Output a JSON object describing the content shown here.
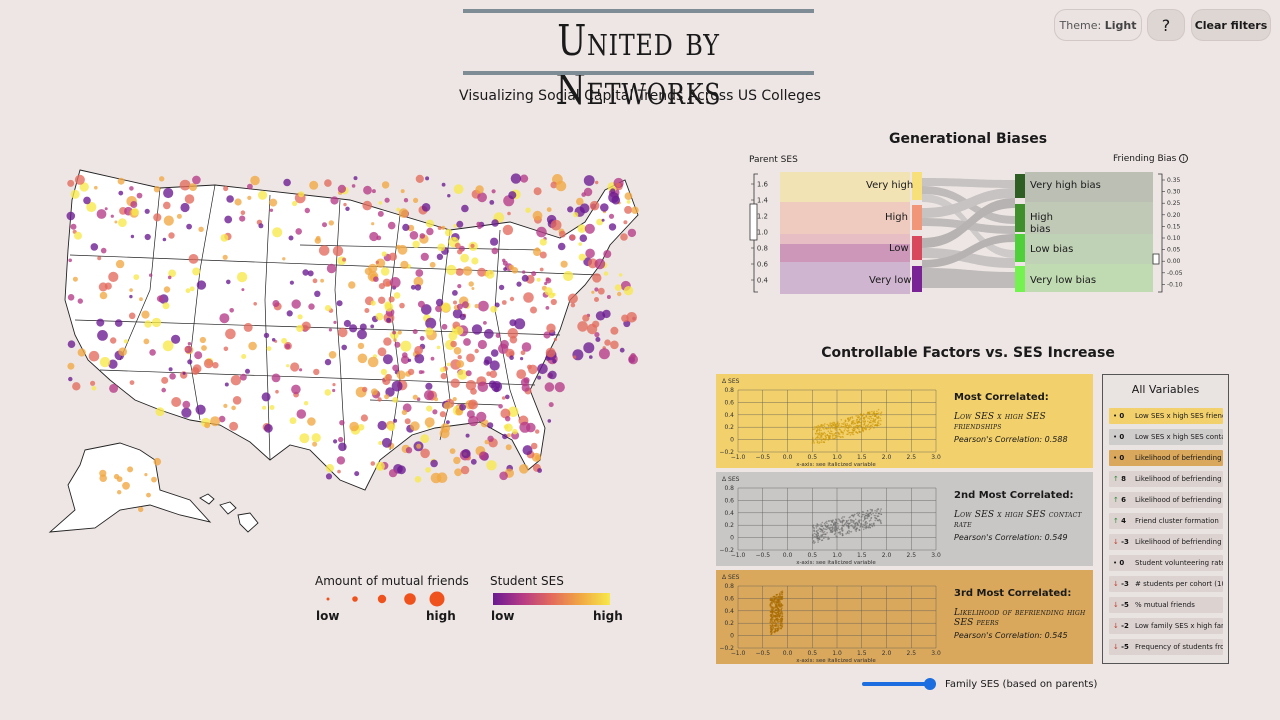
{
  "header": {
    "title": "United by Networks",
    "subtitle": "Visualizing Social Capital Trends Across US Colleges"
  },
  "controls": {
    "theme_prefix": "Theme:",
    "theme_value": "Light",
    "help_label": "?",
    "clear_label": "Clear filters"
  },
  "legend": {
    "size_title": "Amount of mutual friends",
    "size_low": "low",
    "size_high": "high",
    "color_title": "Student SES",
    "color_low": "low",
    "color_high": "high",
    "colors": [
      "#6a1a91",
      "#b53a86",
      "#e36a5c",
      "#f1a843",
      "#f7e84a"
    ]
  },
  "sankey": {
    "title": "Generational Biases",
    "left_axis_title": "Parent SES",
    "right_axis_title": "Friending Bias",
    "info_icon": "info-icon",
    "left_ticks": [
      "1.6",
      "1.4",
      "1.2",
      "1.0",
      "0.8",
      "0.6",
      "0.4"
    ],
    "right_ticks": [
      "0.35",
      "0.30",
      "0.25",
      "0.20",
      "0.15",
      "0.10",
      "0.05",
      "0.00",
      "-0.05",
      "-0.10"
    ],
    "left_nodes": [
      {
        "label": "Very high",
        "color": "#f7e07a"
      },
      {
        "label": "High",
        "color": "#f2967a"
      },
      {
        "label": "Low",
        "color": "#d9495e"
      },
      {
        "label": "Very low",
        "color": "#7a2396"
      }
    ],
    "right_nodes": [
      {
        "label": "Very high bias",
        "color": "#2f5e25"
      },
      {
        "label": "High bias",
        "color": "#3f8f2c"
      },
      {
        "label": "Low bias",
        "color": "#4fcf39"
      },
      {
        "label": "Very low bias",
        "color": "#74f24f"
      }
    ]
  },
  "factors": {
    "title": "Controllable Factors vs. SES Increase",
    "axis_y_label": "Δ SES",
    "axis_x_note": "x-axis: see italicized variable",
    "y_ticks": [
      "0.8",
      "0.6",
      "0.4",
      "0.2",
      "0",
      "−0.2"
    ],
    "x_ticks": [
      "−1.0",
      "−0.5",
      "0.0",
      "0.5",
      "1.0",
      "1.5",
      "2.0",
      "2.5",
      "3.0"
    ],
    "panels": [
      {
        "heading": "Most Correlated:",
        "variable": "Low SES x high SES friendships",
        "correlation": "Pearson's Correlation: 0.588",
        "bg": "#f2d06c",
        "dot": "#c99400"
      },
      {
        "heading": "2nd Most Correlated:",
        "variable": "Low SES x high SES contact rate",
        "correlation": "Pearson's Correlation: 0.549",
        "bg": "#c9c7c5",
        "dot": "#6b6b6b"
      },
      {
        "heading": "3rd Most Correlated:",
        "variable": "Likelihood of befriending high SES peers",
        "correlation": "Pearson's Correlation: 0.545",
        "bg": "#d9a85c",
        "dot": "#a86a00"
      }
    ]
  },
  "all_variables": {
    "title": "All Variables",
    "items": [
      {
        "arrow": "•",
        "change": "0",
        "label": "Low SES x high SES friends",
        "bg": "#f2d06c",
        "dir": "none"
      },
      {
        "arrow": "•",
        "change": "0",
        "label": "Low SES x high SES contac",
        "bg": "#cfcccc",
        "dir": "none"
      },
      {
        "arrow": "•",
        "change": "0",
        "label": "Likelihood of befriending h",
        "bg": "#d9a85c",
        "dir": "none"
      },
      {
        "arrow": "↑",
        "change": "8",
        "label": "Likelihood of befriending p",
        "bg": "#dcd3d1",
        "dir": "up"
      },
      {
        "arrow": "↑",
        "change": "6",
        "label": "Likelihood of befriending p",
        "bg": "#dcd3d1",
        "dir": "up"
      },
      {
        "arrow": "↑",
        "change": "4",
        "label": "Friend cluster formation",
        "bg": "#dcd3d1",
        "dir": "up"
      },
      {
        "arrow": "↓",
        "change": "-3",
        "label": "Likelihood of befriending p",
        "bg": "#dcd3d1",
        "dir": "down"
      },
      {
        "arrow": "•",
        "change": "0",
        "label": "Student volunteering rate",
        "bg": "#dcd3d1",
        "dir": "none"
      },
      {
        "arrow": "↓",
        "change": "-3",
        "label": "# students per cohort (100",
        "bg": "#dcd3d1",
        "dir": "down"
      },
      {
        "arrow": "↓",
        "change": "-5",
        "label": "% mutual friends",
        "bg": "#dcd3d1",
        "dir": "down"
      },
      {
        "arrow": "↓",
        "change": "-2",
        "label": "Low family SES x high fami",
        "bg": "#dcd3d1",
        "dir": "down"
      },
      {
        "arrow": "↓",
        "change": "-5",
        "label": "Frequency of students fror",
        "bg": "#dcd3d1",
        "dir": "down"
      }
    ]
  },
  "slider": {
    "label": "Family SES (based on parents)",
    "value_fraction": 0.92
  }
}
